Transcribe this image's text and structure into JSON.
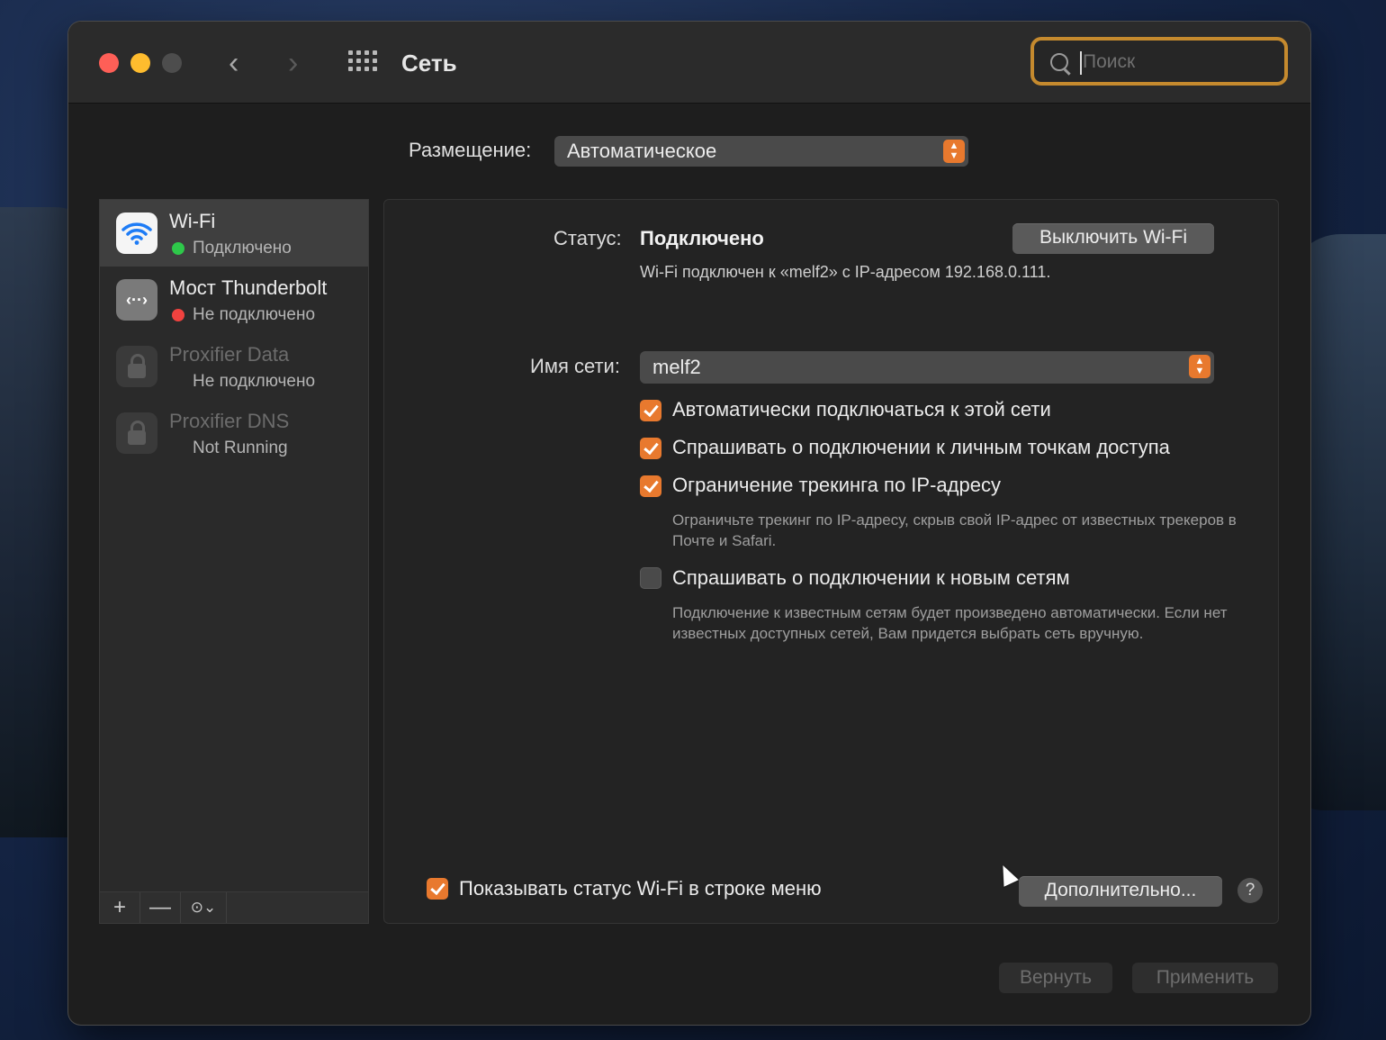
{
  "window": {
    "title": "Сеть"
  },
  "search": {
    "placeholder": "Поиск",
    "value": ""
  },
  "location": {
    "label": "Размещение:",
    "value": "Автоматическое"
  },
  "sidebar": {
    "services": [
      {
        "name": "Wi-Fi",
        "status": "Подключено",
        "status_color": "#2ec84a",
        "icon": "wifi-icon"
      },
      {
        "name": "Мост Thunderbolt",
        "status": "Не подключено",
        "status_color": "#f1423f",
        "icon": "thunderbolt-bridge-icon"
      },
      {
        "name": "Proxifier Data",
        "status": "Не подключено",
        "icon": "lock-icon"
      },
      {
        "name": "Proxifier DNS",
        "status": "Not Running",
        "icon": "lock-icon"
      }
    ],
    "toolbar": {
      "add": "+",
      "remove": "—",
      "more": "⊙⌄"
    }
  },
  "panel": {
    "status_label": "Статус:",
    "status_value": "Подключено",
    "wifi_off_button": "Выключить Wi-Fi",
    "status_description": "Wi-Fi подключен к «melf2» с IP-адресом 192.168.0.111.",
    "network_name_label": "Имя сети:",
    "network_name": "melf2",
    "options": [
      {
        "label": "Автоматически подключаться к этой сети",
        "checked": true
      },
      {
        "label": "Спрашивать о подключении к личным точкам доступа",
        "checked": true
      },
      {
        "label": "Ограничение трекинга по IP-адресу",
        "checked": true,
        "hint": "Ограничьте трекинг по IP-адресу, скрыв свой IP-адрес от известных трекеров в Почте и Safari."
      },
      {
        "label": "Спрашивать о подключении к новым сетям",
        "checked": false,
        "hint": "Подключение к известным сетям будет произведено автоматически. Если нет известных доступных сетей, Вам придется выбрать сеть вручную."
      }
    ],
    "show_status_checkbox": {
      "label": "Показывать статус Wi-Fi в строке меню",
      "checked": true
    },
    "advanced_button": "Дополнительно...",
    "help_button": "?"
  },
  "footer": {
    "revert_button": "Вернуть",
    "apply_button": "Применить"
  },
  "colors": {
    "accent": "#e8792e",
    "search_focus": "#c58a2e"
  }
}
